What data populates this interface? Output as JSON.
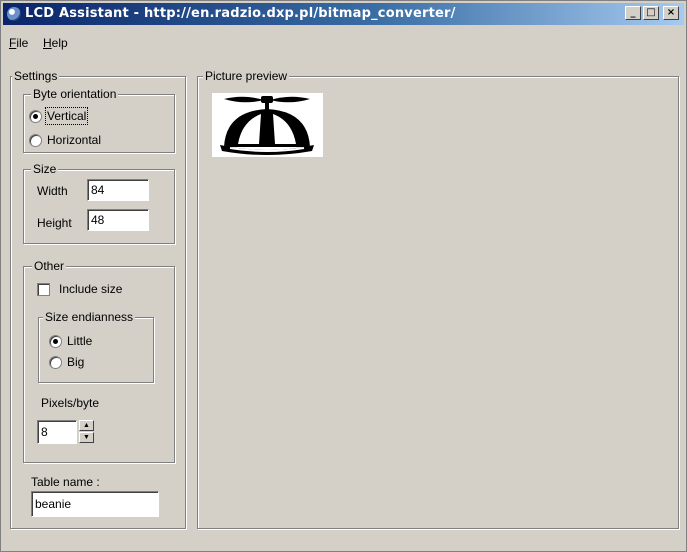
{
  "window": {
    "title": "LCD Assistant -  http://en.radzio.dxp.pl/bitmap_converter/",
    "buttons": {
      "minimize": "_",
      "maximize": "□",
      "close": "×"
    }
  },
  "menu": {
    "file": {
      "accel": "F",
      "rest": "ile"
    },
    "help": {
      "accel": "H",
      "rest": "elp"
    }
  },
  "settings": {
    "title": "Settings",
    "byte_orientation": {
      "title": "Byte orientation",
      "options": [
        "Vertical",
        "Horizontal"
      ],
      "selected": "Vertical"
    },
    "size": {
      "title": "Size",
      "width_label": "Width",
      "width_value": "84",
      "height_label": "Height",
      "height_value": "48"
    },
    "other": {
      "title": "Other",
      "include_size_label": "Include size",
      "include_size_checked": false,
      "endianness": {
        "title": "Size endianness",
        "options": [
          "Little",
          "Big"
        ],
        "selected": "Little"
      },
      "pixels_per_byte_label": "Pixels/byte",
      "pixels_per_byte_value": "8"
    },
    "table_name_label": "Table name :",
    "table_name_value": "beanie"
  },
  "preview": {
    "title": "Picture preview",
    "image": "propeller-beanie-icon"
  }
}
